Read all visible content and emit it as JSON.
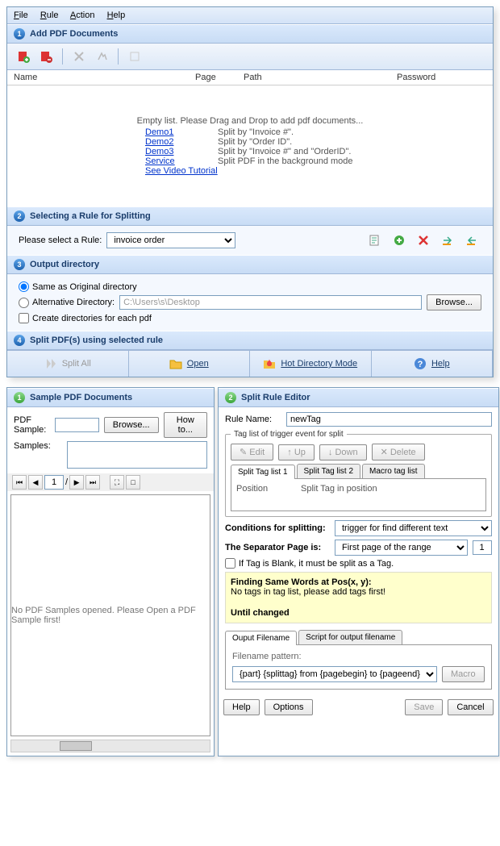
{
  "menu": {
    "file": "File",
    "rule": "Rule",
    "action": "Action",
    "help": "Help"
  },
  "s1": {
    "title": "Add PDF Documents"
  },
  "cols": {
    "name": "Name",
    "page": "Page",
    "path": "Path",
    "password": "Password"
  },
  "empty": {
    "msg": "Empty list. Please Drag and Drop to add pdf documents...",
    "rows": [
      {
        "link": "Demo1",
        "txt": "Split by \"Invoice #\"."
      },
      {
        "link": "Demo2",
        "txt": "Split by \"Order ID\"."
      },
      {
        "link": "Demo3",
        "txt": "Split by \"Invoice #\" and \"OrderID\"."
      },
      {
        "link": "Service",
        "txt": "Split PDF in the background mode"
      }
    ],
    "video": "See Video Tutorial"
  },
  "s2": {
    "title": "Selecting a Rule for Splitting",
    "label": "Please select a Rule:",
    "value": "invoice order"
  },
  "s3": {
    "title": "Output directory",
    "same": "Same as Original directory",
    "alt": "Alternative Directory:",
    "path": "C:\\Users\\s\\Desktop",
    "browse": "Browse...",
    "create": "Create directories for each pdf"
  },
  "s4": {
    "title": "Split PDF(s) using selected rule"
  },
  "big": {
    "split": "Split All",
    "open": "Open",
    "hot": "Hot Directory Mode",
    "help": "Help"
  },
  "left": {
    "title": "Sample PDF Documents",
    "pdfLabel": "PDF Sample:",
    "browse": "Browse...",
    "howto": "How to...",
    "samplesLabel": "Samples:",
    "pageOf": "/",
    "pageVal": "1",
    "noSample": "No PDF Samples opened. Please Open a PDF Sample first!"
  },
  "right": {
    "title": "Split Rule Editor",
    "ruleNameL": "Rule Name:",
    "ruleName": "newTag",
    "tagLegend": "Tag list of trigger event for split",
    "edit": "Edit",
    "up": "Up",
    "down": "Down",
    "delete": "Delete",
    "tab1": "Split Tag list 1",
    "tab2": "Split Tag list 2",
    "tab3": "Macro tag list",
    "colPos": "Position",
    "colTag": "Split Tag in position",
    "condL": "Conditions for splitting:",
    "condV": "trigger for find different text",
    "sepL": "The Separator Page is:",
    "sepV": "First page of the range",
    "sepN": "1",
    "blank": "If Tag is Blank, it must be split as a Tag.",
    "yTitle": "Finding Same Words at Pos(x, y):",
    "yMsg": "No tags in tag list, please add tags first!",
    "yFoot": "Until changed",
    "outTab1": "Ouput Filename",
    "outTab2": "Script for output filename",
    "patL": "Filename pattern:",
    "patV": "{part} {splittag} from {pagebegin} to {pageend}",
    "macro": "Macro",
    "help": "Help",
    "options": "Options",
    "save": "Save",
    "cancel": "Cancel"
  }
}
